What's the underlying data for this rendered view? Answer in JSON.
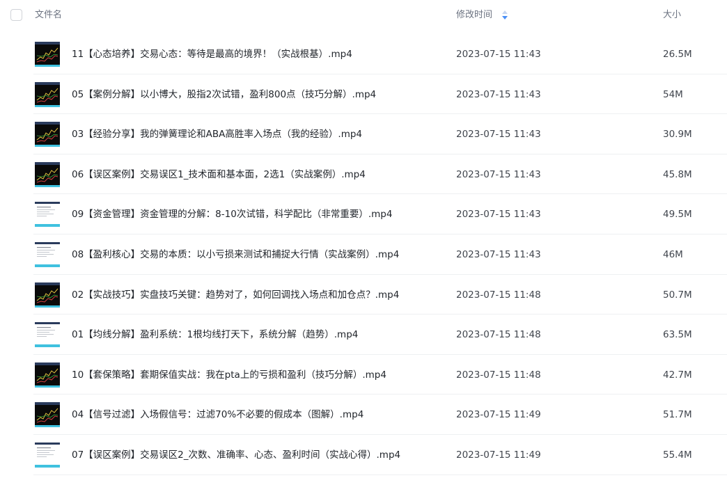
{
  "header": {
    "name_label": "文件名",
    "mtime_label": "修改时间",
    "size_label": "大小"
  },
  "colors": {
    "sort_icon_active": "#4a8ff7",
    "sort_icon_inactive": "#c7d6f0",
    "thumb_dark": "#0a0a0a",
    "thumb_accent": "#3fc1df"
  },
  "files": [
    {
      "name": "11【心态培养】交易心态：等待是最高的境界！（实战根基）.mp4",
      "mtime": "2023-07-15 11:43",
      "size": "26.5M",
      "thumb": "chart-dark"
    },
    {
      "name": "05【案例分解】以小博大，股指2次试错，盈利800点（技巧分解）.mp4",
      "mtime": "2023-07-15 11:43",
      "size": "54M",
      "thumb": "chart-dark"
    },
    {
      "name": "03【经验分享】我的弹簧理论和ABA高胜率入场点（我的经验）.mp4",
      "mtime": "2023-07-15 11:43",
      "size": "30.9M",
      "thumb": "chart-dark"
    },
    {
      "name": "06【误区案例】交易误区1_技术面和基本面，2选1（实战案例）.mp4",
      "mtime": "2023-07-15 11:43",
      "size": "45.8M",
      "thumb": "chart-dark"
    },
    {
      "name": "09【资金管理】资金管理的分解：8-10次试错，科学配比（非常重要）.mp4",
      "mtime": "2023-07-15 11:43",
      "size": "49.5M",
      "thumb": "doc-light"
    },
    {
      "name": "08【盈利核心】交易的本质：以小亏损来测试和捕捉大行情（实战案例）.mp4",
      "mtime": "2023-07-15 11:43",
      "size": "46M",
      "thumb": "doc-light"
    },
    {
      "name": "02【实战技巧】实盘技巧关键：趋势对了，如何回调找入场点和加仓点？.mp4",
      "mtime": "2023-07-15 11:48",
      "size": "50.7M",
      "thumb": "chart-dark"
    },
    {
      "name": "01【均线分解】盈利系统：1根均线打天下，系统分解（趋势）.mp4",
      "mtime": "2023-07-15 11:48",
      "size": "63.5M",
      "thumb": "doc-light"
    },
    {
      "name": "10【套保策略】套期保值实战：我在pta上的亏损和盈利（技巧分解）.mp4",
      "mtime": "2023-07-15 11:48",
      "size": "42.7M",
      "thumb": "chart-dark"
    },
    {
      "name": "04【信号过滤】入场假信号：过滤70%不必要的假成本（图解）.mp4",
      "mtime": "2023-07-15 11:49",
      "size": "51.7M",
      "thumb": "chart-dark"
    },
    {
      "name": "07【误区案例】交易误区2_次数、准确率、心态、盈利时间（实战心得）.mp4",
      "mtime": "2023-07-15 11:49",
      "size": "55.4M",
      "thumb": "doc-light"
    }
  ]
}
